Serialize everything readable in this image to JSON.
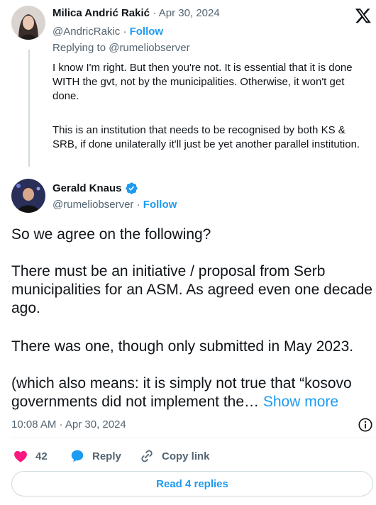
{
  "reply_tweet": {
    "author_name": "Milica Andrić Rakić",
    "date": "Apr 30, 2024",
    "handle": "@AndricRakic",
    "follow_label": "Follow",
    "replying_to": "Replying to @rumeliobserver",
    "paragraph_1": "I know I'm right. But then you're not. It is essential that it is done WITH the gvt, not by the municipalities. Otherwise, it won't get done.",
    "paragraph_2": "This is an institution that needs to be recognised by both KS & SRB, if done unilaterally it'll just be yet another parallel institution."
  },
  "main_tweet": {
    "author_name": "Gerald Knaus",
    "handle": "@rumeliobserver",
    "follow_label": "Follow",
    "paragraph_1": "So we agree on the following?",
    "paragraph_2": "There must be an initiative / proposal from Serb municipalities for an ASM. As agreed even one decade ago.",
    "paragraph_3": "There was one, though only submitted in May 2023.",
    "paragraph_4": "(which also means: it is simply not true that “kosovo governments did not implement the…",
    "show_more_label": "Show more",
    "timestamp": "10:08 AM · Apr 30, 2024",
    "like_count": "42",
    "reply_label": "Reply",
    "copy_link_label": "Copy link",
    "read_replies_label": "Read 4 replies"
  },
  "colors": {
    "accent": "#1d9bf0",
    "like": "#f91880",
    "muted": "#536471",
    "verified": "#1d9bf0"
  },
  "icons": [
    "x-logo-icon",
    "verified-badge-icon",
    "info-icon",
    "heart-icon",
    "reply-bubble-icon",
    "link-icon"
  ]
}
